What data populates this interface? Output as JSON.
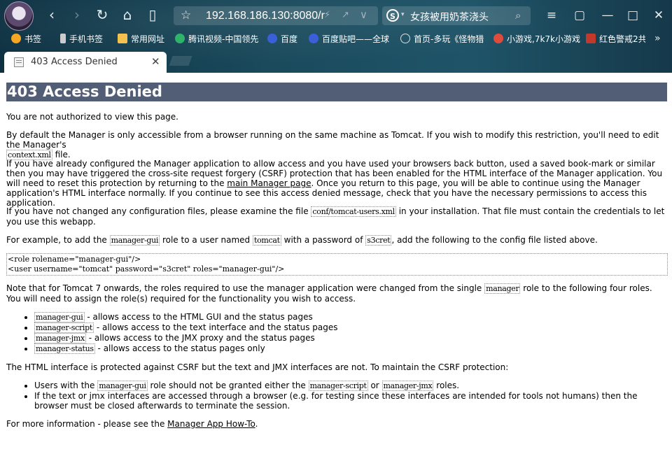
{
  "browser": {
    "url": "192.168.186.130:8080/r",
    "search_text": "女孩被用奶茶浇头",
    "search_engine_logo": "S",
    "nav_icons": [
      "back-icon",
      "forward-icon",
      "refresh-icon",
      "home-icon",
      "reader-icon"
    ],
    "window_icons": [
      "menu-icon",
      "store-icon",
      "minimize-icon",
      "maximize-icon",
      "close-icon"
    ]
  },
  "bookmarks": [
    {
      "label": "书签",
      "icon": "star-icon",
      "color": "#f5a623"
    },
    {
      "label": "手机书签",
      "icon": "phone-icon",
      "color": "#cccccc"
    },
    {
      "label": "常用网址",
      "icon": "folder-icon",
      "color": "#f2c14e"
    },
    {
      "label": "腾讯视频-中国领先",
      "icon": "video-icon",
      "color": "#2fb36b"
    },
    {
      "label": "百度",
      "icon": "baidu-icon",
      "color": "#3a5fd9"
    },
    {
      "label": "百度贴吧——全球",
      "icon": "tieba-icon",
      "color": "#3a5fd9"
    },
    {
      "label": "首页-多玩《怪物猎",
      "icon": "globe-icon",
      "color": "#dddddd"
    },
    {
      "label": "小游戏,7k7k小游戏",
      "icon": "game-icon",
      "color": "#e04b3c"
    },
    {
      "label": "红色警戒2共",
      "icon": "ra2-icon",
      "color": "#c0392b"
    }
  ],
  "tab": {
    "title": "403 Access Denied"
  },
  "page": {
    "heading": "403 Access Denied",
    "p1": "You are not authorized to view this page.",
    "p2a": "By default the Manager is only accessible from a browser running on the same machine as Tomcat. If you wish to modify this restriction, you'll need to edit the Manager's",
    "p2_code": "context.xml",
    "p2b": " file.",
    "p3a": "If you have already configured the Manager application to allow access and you have used your browsers back button, used a saved book-mark or similar then you may have triggered the cross-site request forgery (CSRF) protection that has been enabled for the HTML interface of the Manager application. You will need to reset this protection by returning to the ",
    "p3_link": "main Manager page",
    "p3b": ". Once you return to this page, you will be able to continue using the Manager application's HTML interface normally. If you continue to see this access denied message, check that you have the necessary permissions to access this application.",
    "p4a": "If you have not changed any configuration files, please examine the file ",
    "p4_code": "conf/tomcat-users.xml",
    "p4b": " in your installation. That file must contain the credentials to let you use this webapp.",
    "p5a": "For example, to add the ",
    "p5_code1": "manager-gui",
    "p5b": " role to a user named ",
    "p5_code2": "tomcat",
    "p5c": " with a password of ",
    "p5_code3": "s3cret",
    "p5d": ", add the following to the config file listed above.",
    "pre_line1": "<role rolename=\"manager-gui\"/>",
    "pre_line2": "<user username=\"tomcat\" password=\"s3cret\" roles=\"manager-gui\"/>",
    "p6a": "Note that for Tomcat 7 onwards, the roles required to use the manager application were changed from the single ",
    "p6_code": "manager",
    "p6b": " role to the following four roles. You will need to assign the role(s) required for the functionality you wish to access.",
    "roles": [
      {
        "code": "manager-gui",
        "text": " - allows access to the HTML GUI and the status pages"
      },
      {
        "code": "manager-script",
        "text": " - allows access to the text interface and the status pages"
      },
      {
        "code": "manager-jmx",
        "text": " - allows access to the JMX proxy and the status pages"
      },
      {
        "code": "manager-status",
        "text": " - allows access to the status pages only"
      }
    ],
    "p7": "The HTML interface is protected against CSRF but the text and JMX interfaces are not. To maintain the CSRF protection:",
    "csrf1a": "Users with the ",
    "csrf1_code1": "manager-gui",
    "csrf1b": " role should not be granted either the ",
    "csrf1_code2": "manager-script",
    "csrf1c": " or ",
    "csrf1_code3": "manager-jmx",
    "csrf1d": " roles.",
    "csrf2": "If the text or jmx interfaces are accessed through a browser (e.g. for testing since these interfaces are intended for tools not humans) then the browser must be closed afterwards to terminate the session.",
    "p8a": "For more information - please see the ",
    "p8_link": "Manager App How-To",
    "p8b": "."
  }
}
